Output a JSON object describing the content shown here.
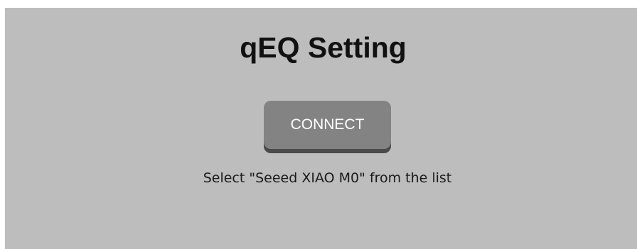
{
  "page": {
    "title": "qEQ Setting",
    "connect_label": "CONNECT",
    "instruction": "Select \"Seeed XIAO M0\" from the list"
  },
  "colors": {
    "panel_background": "#bdbdbd",
    "button_background": "#838383",
    "button_shadow": "#4a4a4a",
    "button_text": "#ffffff",
    "title_text": "#111111"
  }
}
